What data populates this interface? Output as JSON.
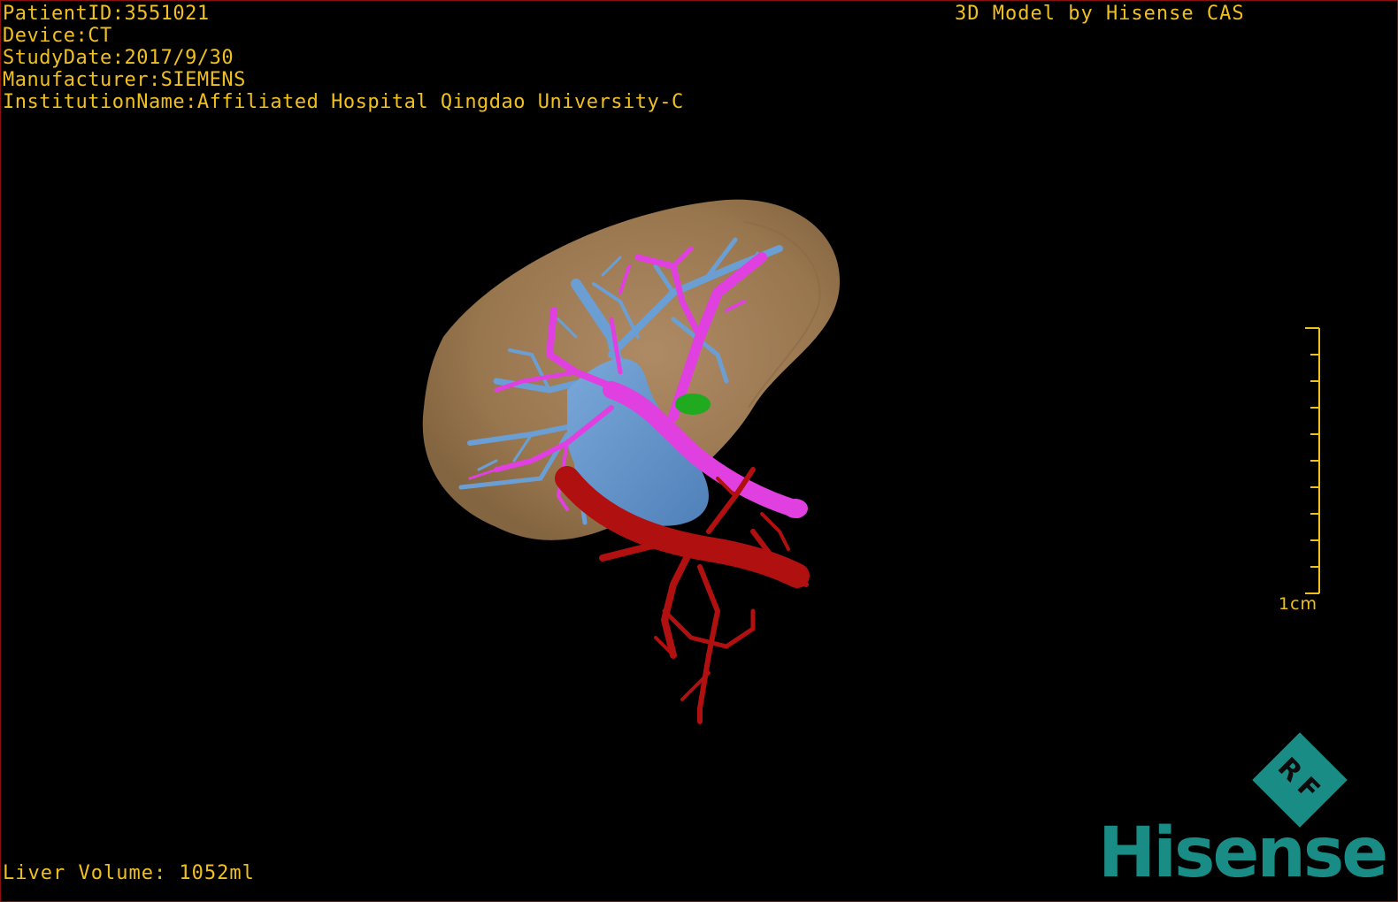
{
  "overlay": {
    "patient_id": "PatientID:3551021",
    "device": "Device:CT",
    "study_date": "StudyDate:2017/9/30",
    "manufacturer": "Manufacturer:SIEMENS",
    "institution": "InstitutionName:Affiliated Hospital Qingdao University-C",
    "credit": "3D Model by Hisense CAS",
    "liver_volume": "Liver Volume: 1052ml"
  },
  "scale_bar": {
    "label": "1cm"
  },
  "logo": {
    "badge_text": "RF",
    "brand": "Hisense"
  },
  "colors": {
    "overlay_text": "#f0c020",
    "liver": "#a8845a",
    "portal_vein": "#e040e0",
    "hepatic_vein": "#6b9fd4",
    "artery": "#b01010",
    "lesion": "#1faa1f",
    "brand": "#1a8c86"
  }
}
